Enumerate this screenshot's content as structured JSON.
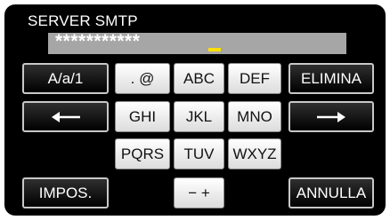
{
  "title": "SERVER SMTP",
  "field": {
    "value": "***********"
  },
  "keys": {
    "case": "A/a/1",
    "symbols": ". @",
    "abc": "ABC",
    "def": "DEF",
    "delete": "ELIMINA",
    "left_icon": "arrow-left-icon",
    "ghi": "GHI",
    "jkl": "JKL",
    "mno": "MNO",
    "right_icon": "arrow-right-icon",
    "pqrs": "PQRS",
    "tuv": "TUV",
    "wxyz": "WXYZ",
    "set": "IMPOS.",
    "minus_plus": "− +",
    "cancel": "ANNULLA"
  },
  "colors": {
    "screen_bg": "#000000",
    "field_bg": "#a6a6a6",
    "cursor": "#ffe000",
    "light_key": "#f0f0f0",
    "dark_key": "#000000"
  }
}
